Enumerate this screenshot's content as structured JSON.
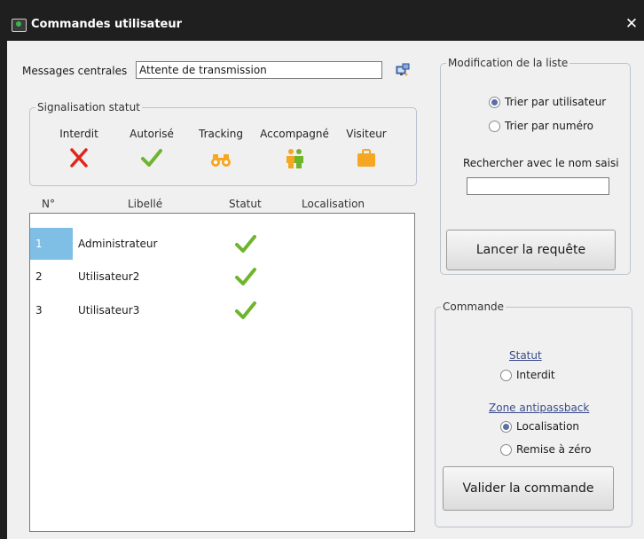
{
  "window": {
    "title": "Commandes utilisateur",
    "close": "✕"
  },
  "messages": {
    "label": "Messages centrales",
    "value": "Attente de transmission"
  },
  "signalisation": {
    "legend": "Signalisation statut",
    "items": [
      {
        "label": "Interdit",
        "icon": "red-cross-icon"
      },
      {
        "label": "Autorisé",
        "icon": "green-check-icon"
      },
      {
        "label": "Tracking",
        "icon": "binoculars-icon"
      },
      {
        "label": "Accompagné",
        "icon": "people-icon"
      },
      {
        "label": "Visiteur",
        "icon": "suitcase-icon"
      }
    ]
  },
  "table": {
    "headers": [
      "N°",
      "Libellé",
      "Statut",
      "Localisation"
    ],
    "rows": [
      {
        "num": "1",
        "name": "Administrateur"
      },
      {
        "num": "2",
        "name": "Utilisateur2"
      },
      {
        "num": "3",
        "name": "Utilisateur3"
      }
    ]
  },
  "modification": {
    "legend": "Modification de la liste",
    "sort_user": "Trier par utilisateur",
    "sort_number": "Trier par numéro",
    "search_label": "Rechercher avec le nom saisi",
    "button": "Lancer la requête"
  },
  "commande": {
    "legend": "Commande",
    "statut_title": "Statut",
    "statut_option": "Interdit",
    "zone_title": "Zone antipassback",
    "zone_localisation": "Localisation",
    "zone_reset": "Remise à zéro",
    "button": "Valider la commande"
  },
  "colors": {
    "accent_green": "#6fb52c",
    "cross_red": "#e0261b",
    "selection": "#7fbfe6",
    "orange": "#f5a623"
  }
}
